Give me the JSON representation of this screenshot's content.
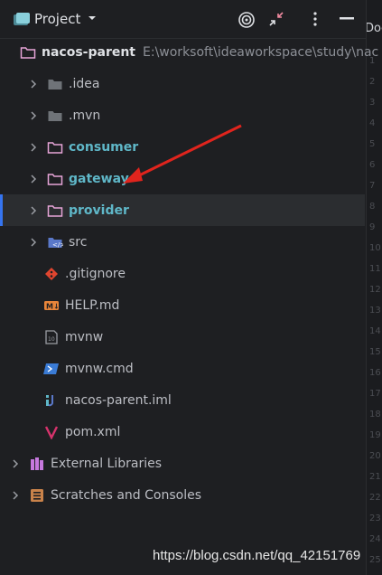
{
  "panel": {
    "title": "Project"
  },
  "editor": {
    "tab_fragment": "Doc",
    "line_numbers": [
      "1",
      "2",
      "3",
      "4",
      "5",
      "6",
      "7",
      "8",
      "9",
      "10",
      "11",
      "12",
      "13",
      "14",
      "15",
      "16",
      "17",
      "18",
      "19",
      "20",
      "21",
      "22",
      "23",
      "24",
      "25"
    ]
  },
  "tree": {
    "root": {
      "label": "nacos-parent",
      "path": "E:\\worksoft\\ideaworkspace\\study\\nac"
    },
    "items": [
      {
        "label": ".idea"
      },
      {
        "label": ".mvn"
      },
      {
        "label": "consumer"
      },
      {
        "label": "gateway"
      },
      {
        "label": "provider"
      },
      {
        "label": "src"
      },
      {
        "label": ".gitignore"
      },
      {
        "label": "HELP.md"
      },
      {
        "label": "mvnw"
      },
      {
        "label": "mvnw.cmd"
      },
      {
        "label": "nacos-parent.iml"
      },
      {
        "label": "pom.xml"
      }
    ],
    "external_libraries": "External Libraries",
    "scratches": "Scratches and Consoles"
  },
  "watermark": "https://blog.csdn.net/qq_42151769",
  "colors": {
    "module_folder": "#5fb7c8",
    "selection": "#2b2d30",
    "accent": "#3574f0",
    "annotation_arrow": "#e0241d"
  }
}
